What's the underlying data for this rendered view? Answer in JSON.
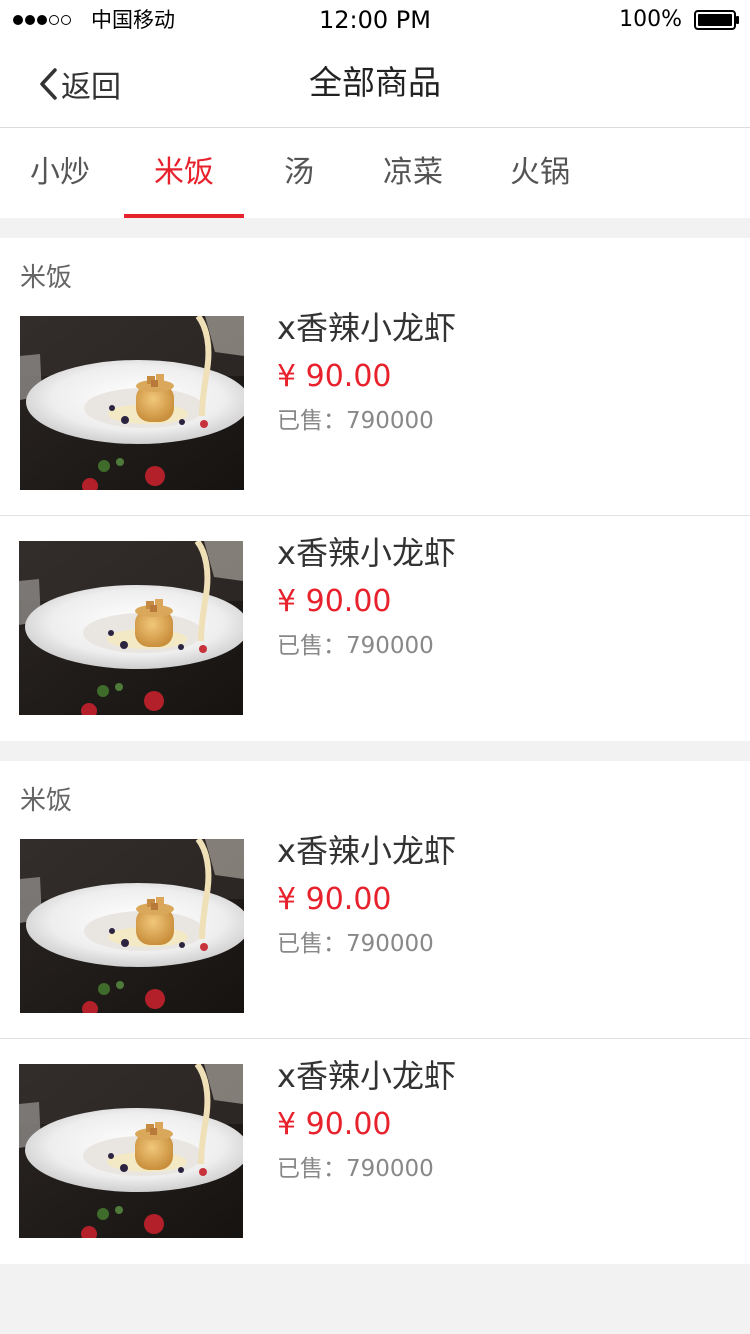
{
  "status_bar": {
    "carrier": "中国移动",
    "time": "12:00 PM",
    "battery": "100%",
    "signal_bars_filled": 3,
    "signal_bars_total": 5
  },
  "nav": {
    "back_label": "返回",
    "title": "全部商品"
  },
  "tabs": [
    {
      "label": "小炒"
    },
    {
      "label": "米饭",
      "active": true
    },
    {
      "label": "汤"
    },
    {
      "label": "凉菜"
    },
    {
      "label": "火锅"
    }
  ],
  "sections": [
    {
      "title": "米饭",
      "items": [
        {
          "name": "x香辣小龙虾",
          "price": "¥ 90.00",
          "sold": "已售：790000"
        },
        {
          "name": "x香辣小龙虾",
          "price": "¥ 90.00",
          "sold": "已售：790000"
        }
      ]
    },
    {
      "title": "米饭",
      "items": [
        {
          "name": "x香辣小龙虾",
          "price": "¥ 90.00",
          "sold": "已售：790000"
        },
        {
          "name": "x香辣小龙虾",
          "price": "¥ 90.00",
          "sold": "已售：790000"
        }
      ]
    }
  ],
  "colors": {
    "accent": "#e8222d",
    "background": "#f2f2f2",
    "surface": "#ffffff",
    "text_primary": "#333333",
    "text_secondary": "#888888"
  },
  "icons": {
    "back": "chevron-left-icon",
    "battery": "battery-icon",
    "signal": "signal-dots-icon",
    "food": "dessert-plate-photo"
  }
}
